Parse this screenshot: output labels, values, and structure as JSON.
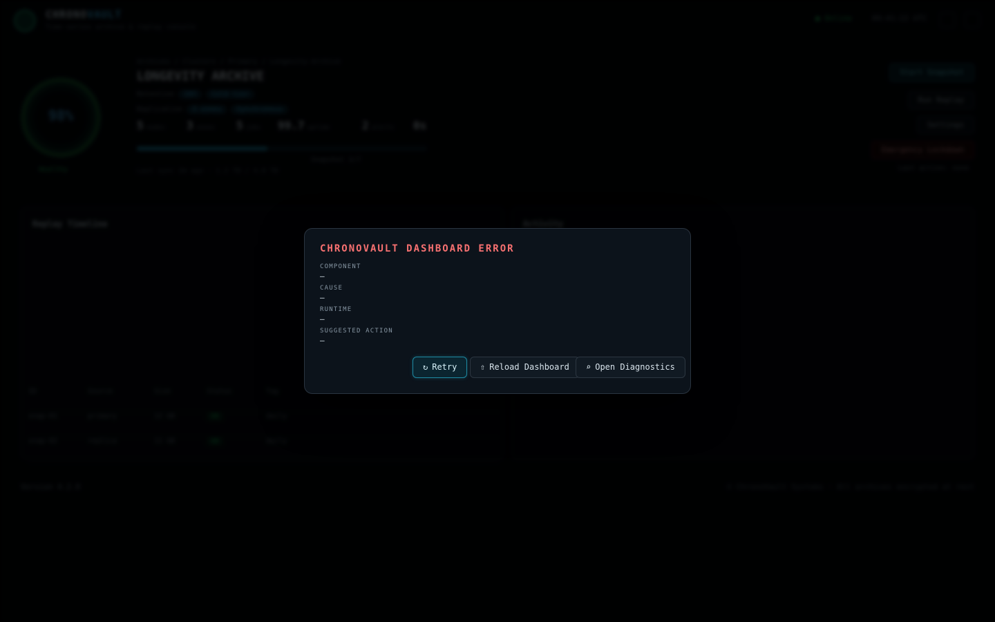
{
  "background": {
    "brand": {
      "name_a": "CHRONO",
      "name_b": "VAULT",
      "subtitle": "Time-series archive & replay console"
    },
    "top": {
      "status": "● Online",
      "time": "09:41:22 UTC"
    },
    "ring": {
      "value": "98%",
      "caption": "Healthy"
    },
    "header": {
      "breadcrumb": "Archives / Clusters / Primary / Longevity-Archive",
      "title": "LONGEVITY ARCHIVE",
      "meta_1_label": "Retention",
      "meta_1_pills": [
        "10Y",
        "Cold tier"
      ],
      "meta_2_label": "Replication",
      "meta_2_pills": [
        "3 zones",
        "Synchronous"
      ],
      "stats": [
        {
          "value": "5",
          "label": "nodes"
        },
        {
          "value": "3",
          "label": "zones"
        },
        {
          "value": "5",
          "label": "jobs"
        },
        {
          "value": "99.7",
          "label": "uptime"
        },
        {
          "value": "2",
          "label": "alerts"
        },
        {
          "value": "0s",
          "label": ""
        }
      ],
      "progress_percent": 45,
      "progress_note": "Snapshot 3/7",
      "footer": "Last sync 2m ago · 1.2 TB / 4.8 TB"
    },
    "actions": [
      "Start Snapshot",
      "Run Replay",
      "Settings",
      "Emergency Lockdown"
    ],
    "actions_note": "Last action: none",
    "panel_left_title": "Replay Timeline",
    "panel_right_title": "Activity",
    "table": {
      "headers": [
        "ID",
        "Source",
        "Size",
        "Status",
        "Tag"
      ],
      "rows": [
        [
          "snap-01",
          "primary",
          "12 GB",
          "OK",
          "daily"
        ],
        [
          "snap-02",
          "replica",
          "11 GB",
          "OK",
          "daily"
        ]
      ]
    },
    "footer_left": "Version 4.2.0",
    "footer_right": "© ChronoVault Systems · All archives encrypted at rest"
  },
  "modal": {
    "title": "CHRONOVAULT DASHBOARD ERROR",
    "fields": [
      {
        "label": "COMPONENT",
        "value": "—"
      },
      {
        "label": "CAUSE",
        "value": "—"
      },
      {
        "label": "RUNTIME",
        "value": "—"
      },
      {
        "label": "SUGGESTED ACTION",
        "value": "—"
      }
    ],
    "buttons": {
      "retry": {
        "icon": "↻",
        "label": "Retry"
      },
      "reload": {
        "icon": "⇧",
        "label": "Reload Dashboard"
      },
      "diagnostics": {
        "icon": "⌕",
        "label": "Open Diagnostics"
      }
    }
  },
  "colors": {
    "error_title": "#f87171",
    "accent": "#1e8aa3",
    "modal_bg": "#0c131b"
  }
}
